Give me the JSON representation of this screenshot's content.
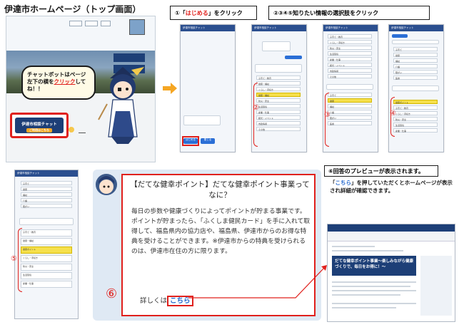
{
  "home": {
    "title": "伊達市ホームページ（トップ画面）",
    "bubble_pre": "チャットボットはページ左下の横を",
    "bubble_click": "クリック",
    "bubble_post": "してね！！",
    "chat_button_label": "伊達市相談チャット",
    "chat_button_sub": "ご利用はこちら"
  },
  "steps": {
    "step1_prefix": "①「",
    "step1_keyword": "はじめる",
    "step1_suffix": "」をクリック",
    "step2to5": "②③④⑤知りたい情報の選択肢をクリック",
    "step6": "⑥回答のプレビューが表示されます。",
    "step6_desc_pre": "「",
    "step6_desc_link": "こちら",
    "step6_desc_post": "」を押していただくとホームページが表示され詳細が確認できます。"
  },
  "phones": {
    "bar_title": "伊達市相談チャット",
    "start_button": "はじめる",
    "no_button": "閉じる",
    "options_a": [
      "子育て・教育",
      "健康・福祉",
      "くらし・手続き",
      "防災・安全",
      "生活環境",
      "産業・仕事",
      "観光・イベント",
      "市政情報",
      "その他"
    ],
    "options_b": [
      "子育て",
      "健康",
      "福祉",
      "介護",
      "障がい",
      "医療"
    ],
    "selected_b": "健康ポイント",
    "numbers": [
      "②",
      "③",
      "④",
      "⑤"
    ]
  },
  "article": {
    "title": "【だてな健幸ポイント】だてな健幸ポイント事業ってなに？",
    "body": "毎日の歩数や健康づくりによってポイントが貯まる事業です。ポイントが貯まったら、「ふくしま健民カード」を手に入れて取得して、福島県内の協力店や、福島県、伊達市からのお得な特典を受けることができます。※伊達市からの特典を受けられるのは、伊達市在住の方に限ります。",
    "more_prefix": "詳しくは",
    "more_link": "こちら",
    "step_number": "⑥"
  },
  "preview": {
    "banner": "だてな健幸ポイント事業～楽しみながら健康づくりで、毎日をお得に！～"
  },
  "colors": {
    "red": "#e0201c",
    "navy": "#1d3f77",
    "blue": "#2266cc",
    "yellow": "#f6e04c"
  }
}
